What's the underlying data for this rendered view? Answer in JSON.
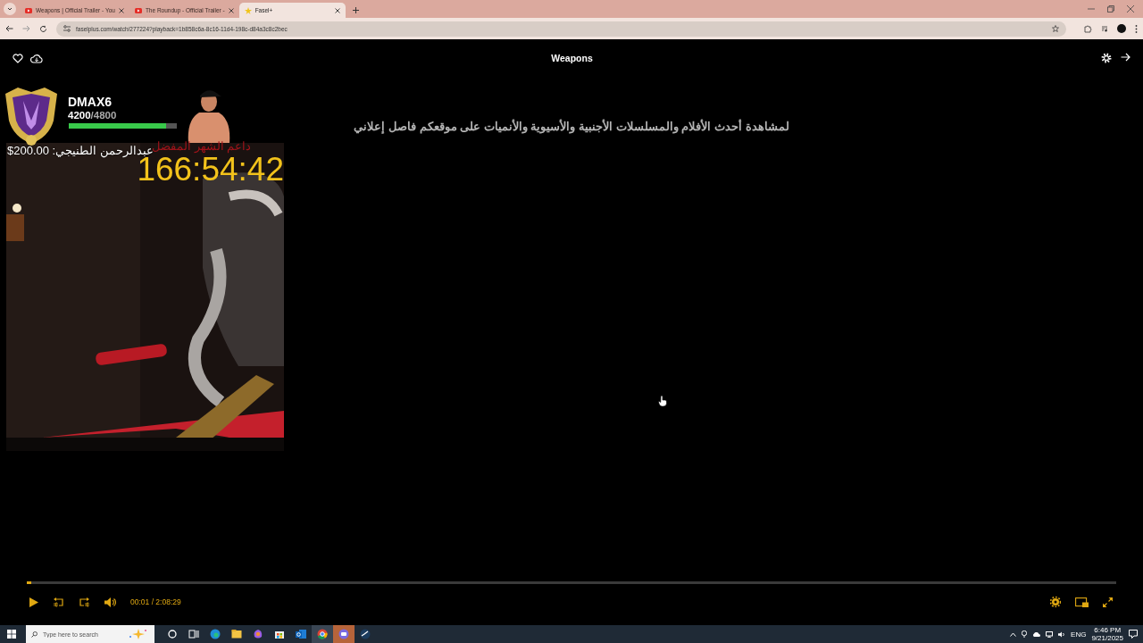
{
  "browser": {
    "tabs": [
      {
        "title": "Weapons | Official Trailer - You",
        "kind": "video",
        "selected": false
      },
      {
        "title": "The Roundup - Official Trailer -",
        "kind": "video",
        "selected": false
      },
      {
        "title": "Fasel+",
        "kind": "site",
        "selected": true
      }
    ],
    "url": "faselplus.com/watch/277224?playback=1b858c6a-8c16-11d4-198c-d84a3c8c2bec"
  },
  "player": {
    "title": "Weapons",
    "banner": "لمشاهدة أحدث الأفلام والمسلسلات الأجنبية والأسيوية والأنميات على موقعكم فاصل إعلاني",
    "progress": {
      "level": 0.004
    },
    "time": "00:01 / 2:08:29"
  },
  "overlay": {
    "name": "DMAX6",
    "xp_current": "4200",
    "xp_total": "/4800",
    "xp": {
      "level": 0.9
    },
    "supporter_label": "داعم الشهر المفضل",
    "donation": "عبدالرحمن الطنيجي: 200.00$",
    "timer": "166:54:42"
  },
  "taskbar": {
    "search_placeholder": "Type here to search",
    "language": "ENG",
    "time": "6:46 PM",
    "date": "9/21/2025"
  }
}
